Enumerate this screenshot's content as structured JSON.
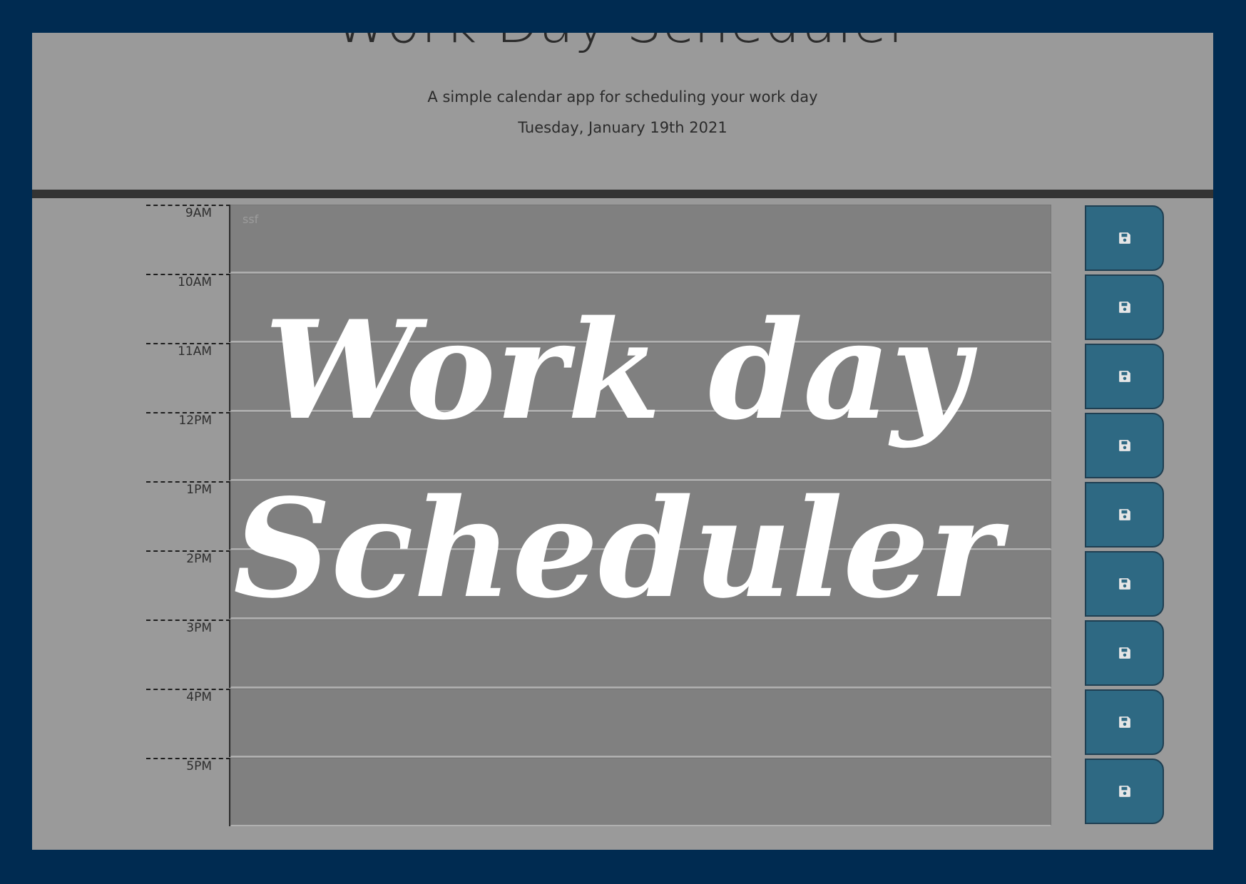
{
  "app": {
    "title": "Work Day Scheduler",
    "subtitle": "A simple calendar app for scheduling your work day",
    "current_day": "Tuesday, January 19th 2021"
  },
  "schedule": {
    "hours": [
      {
        "label": "9AM",
        "text": "ssf"
      },
      {
        "label": "10AM",
        "text": ""
      },
      {
        "label": "11AM",
        "text": ""
      },
      {
        "label": "12PM",
        "text": ""
      },
      {
        "label": "1PM",
        "text": ""
      },
      {
        "label": "2PM",
        "text": ""
      },
      {
        "label": "3PM",
        "text": ""
      },
      {
        "label": "4PM",
        "text": ""
      },
      {
        "label": "5PM",
        "text": ""
      }
    ],
    "save_icon": "save-floppy-icon"
  },
  "overlay": {
    "line1": "Work day",
    "line2": "Scheduler",
    "color": "#ffffff"
  },
  "colors": {
    "frame_border": "#002b51",
    "page_background": "#9a9a9a",
    "description_background": "#808080",
    "save_button": "#2e6983",
    "divider": "#333333"
  }
}
